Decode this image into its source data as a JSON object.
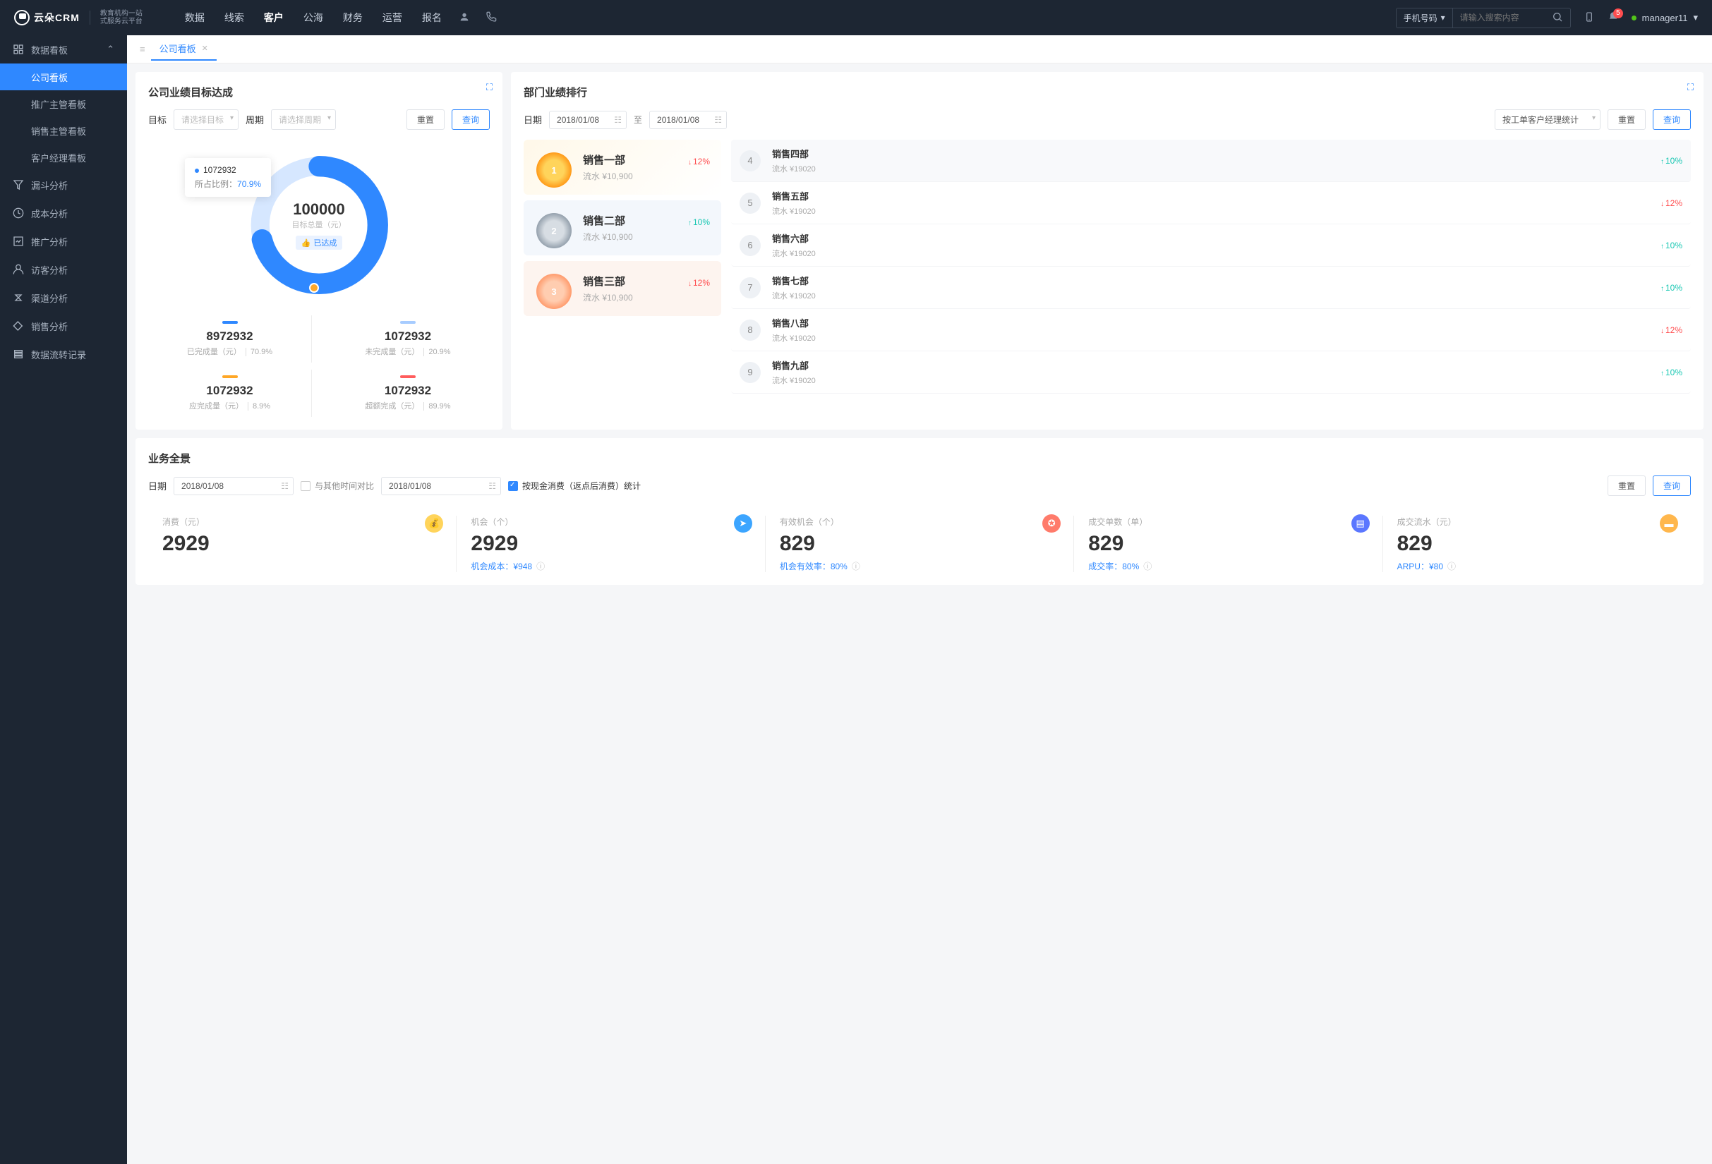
{
  "header": {
    "logo_text": "云朵CRM",
    "logo_sub1": "教育机构一站",
    "logo_sub2": "式服务云平台",
    "nav": [
      "数据",
      "线索",
      "客户",
      "公海",
      "财务",
      "运营",
      "报名"
    ],
    "nav_active": 2,
    "search_type": "手机号码",
    "search_placeholder": "请输入搜索内容",
    "badge": "5",
    "user": "manager11"
  },
  "sidebar": {
    "group_label": "数据看板",
    "children": [
      "公司看板",
      "推广主管看板",
      "销售主管看板",
      "客户经理看板"
    ],
    "child_active": 0,
    "items": [
      "漏斗分析",
      "成本分析",
      "推广分析",
      "访客分析",
      "渠道分析",
      "销售分析",
      "数据流转记录"
    ]
  },
  "tab": {
    "label": "公司看板"
  },
  "target_card": {
    "title": "公司业绩目标达成",
    "label_target": "目标",
    "placeholder_target": "请选择目标",
    "label_period": "周期",
    "placeholder_period": "请选择周期",
    "btn_reset": "重置",
    "btn_query": "查询",
    "donut_total": "100000",
    "donut_label": "目标总量（元）",
    "donut_tag": "已达成",
    "tooltip_value": "1072932",
    "tooltip_ratio_label": "所占比例：",
    "tooltip_ratio": "70.9%",
    "stats": [
      {
        "bar": "b1",
        "num": "8972932",
        "label": "已完成量（元）",
        "pct": "70.9%"
      },
      {
        "bar": "b2",
        "num": "1072932",
        "label": "未完成量（元）",
        "pct": "20.9%"
      },
      {
        "bar": "b3",
        "num": "1072932",
        "label": "应完成量（元）",
        "pct": "8.9%"
      },
      {
        "bar": "b4",
        "num": "1072932",
        "label": "超额完成（元）",
        "pct": "89.9%"
      }
    ]
  },
  "rank_card": {
    "title": "部门业绩排行",
    "label_date": "日期",
    "date_from": "2018/01/08",
    "date_sep": "至",
    "date_to": "2018/01/08",
    "stat_by": "按工单客户经理统计",
    "btn_reset": "重置",
    "btn_query": "查询",
    "top3": [
      {
        "rank": "1",
        "name": "销售一部",
        "sub": "流水 ¥10,900",
        "pct": "12%",
        "dir": "down"
      },
      {
        "rank": "2",
        "name": "销售二部",
        "sub": "流水 ¥10,900",
        "pct": "10%",
        "dir": "up"
      },
      {
        "rank": "3",
        "name": "销售三部",
        "sub": "流水 ¥10,900",
        "pct": "12%",
        "dir": "down"
      }
    ],
    "list": [
      {
        "rank": "4",
        "name": "销售四部",
        "sub": "流水 ¥19020",
        "pct": "10%",
        "dir": "up"
      },
      {
        "rank": "5",
        "name": "销售五部",
        "sub": "流水 ¥19020",
        "pct": "12%",
        "dir": "down"
      },
      {
        "rank": "6",
        "name": "销售六部",
        "sub": "流水 ¥19020",
        "pct": "10%",
        "dir": "up"
      },
      {
        "rank": "7",
        "name": "销售七部",
        "sub": "流水 ¥19020",
        "pct": "10%",
        "dir": "up"
      },
      {
        "rank": "8",
        "name": "销售八部",
        "sub": "流水 ¥19020",
        "pct": "12%",
        "dir": "down"
      },
      {
        "rank": "9",
        "name": "销售九部",
        "sub": "流水 ¥19020",
        "pct": "10%",
        "dir": "up"
      }
    ]
  },
  "overview_card": {
    "title": "业务全景",
    "label_date": "日期",
    "date1": "2018/01/08",
    "chk_compare": "与其他时间对比",
    "date2": "2018/01/08",
    "chk_stat": "按现金消费（返点后消费）统计",
    "btn_reset": "重置",
    "btn_query": "查询",
    "items": [
      {
        "label": "消费（元）",
        "num": "2929",
        "sub": "",
        "ico": "ic1"
      },
      {
        "label": "机会（个）",
        "num": "2929",
        "sub": "机会成本：¥948",
        "ico": "ic2"
      },
      {
        "label": "有效机会（个）",
        "num": "829",
        "sub": "机会有效率：80%",
        "ico": "ic3"
      },
      {
        "label": "成交单数（单）",
        "num": "829",
        "sub": "成交率：80%",
        "ico": "ic4"
      },
      {
        "label": "成交流水（元）",
        "num": "829",
        "sub": "ARPU：¥80",
        "ico": "ic5"
      }
    ]
  },
  "chart_data": {
    "type": "pie",
    "title": "公司业绩目标达成",
    "total_label": "目标总量（元）",
    "total": 100000,
    "slices": [
      {
        "name": "已完成量",
        "value": 8972932,
        "ratio": 70.9,
        "color": "#2f88ff"
      },
      {
        "name": "未完成量",
        "value": 1072932,
        "ratio": 20.9,
        "color": "#a7ccff"
      },
      {
        "name": "应完成量",
        "value": 1072932,
        "ratio": 8.9,
        "color": "#ffa726"
      },
      {
        "name": "超额完成",
        "value": 1072932,
        "ratio": 89.9,
        "color": "#ff5c5c"
      }
    ]
  }
}
